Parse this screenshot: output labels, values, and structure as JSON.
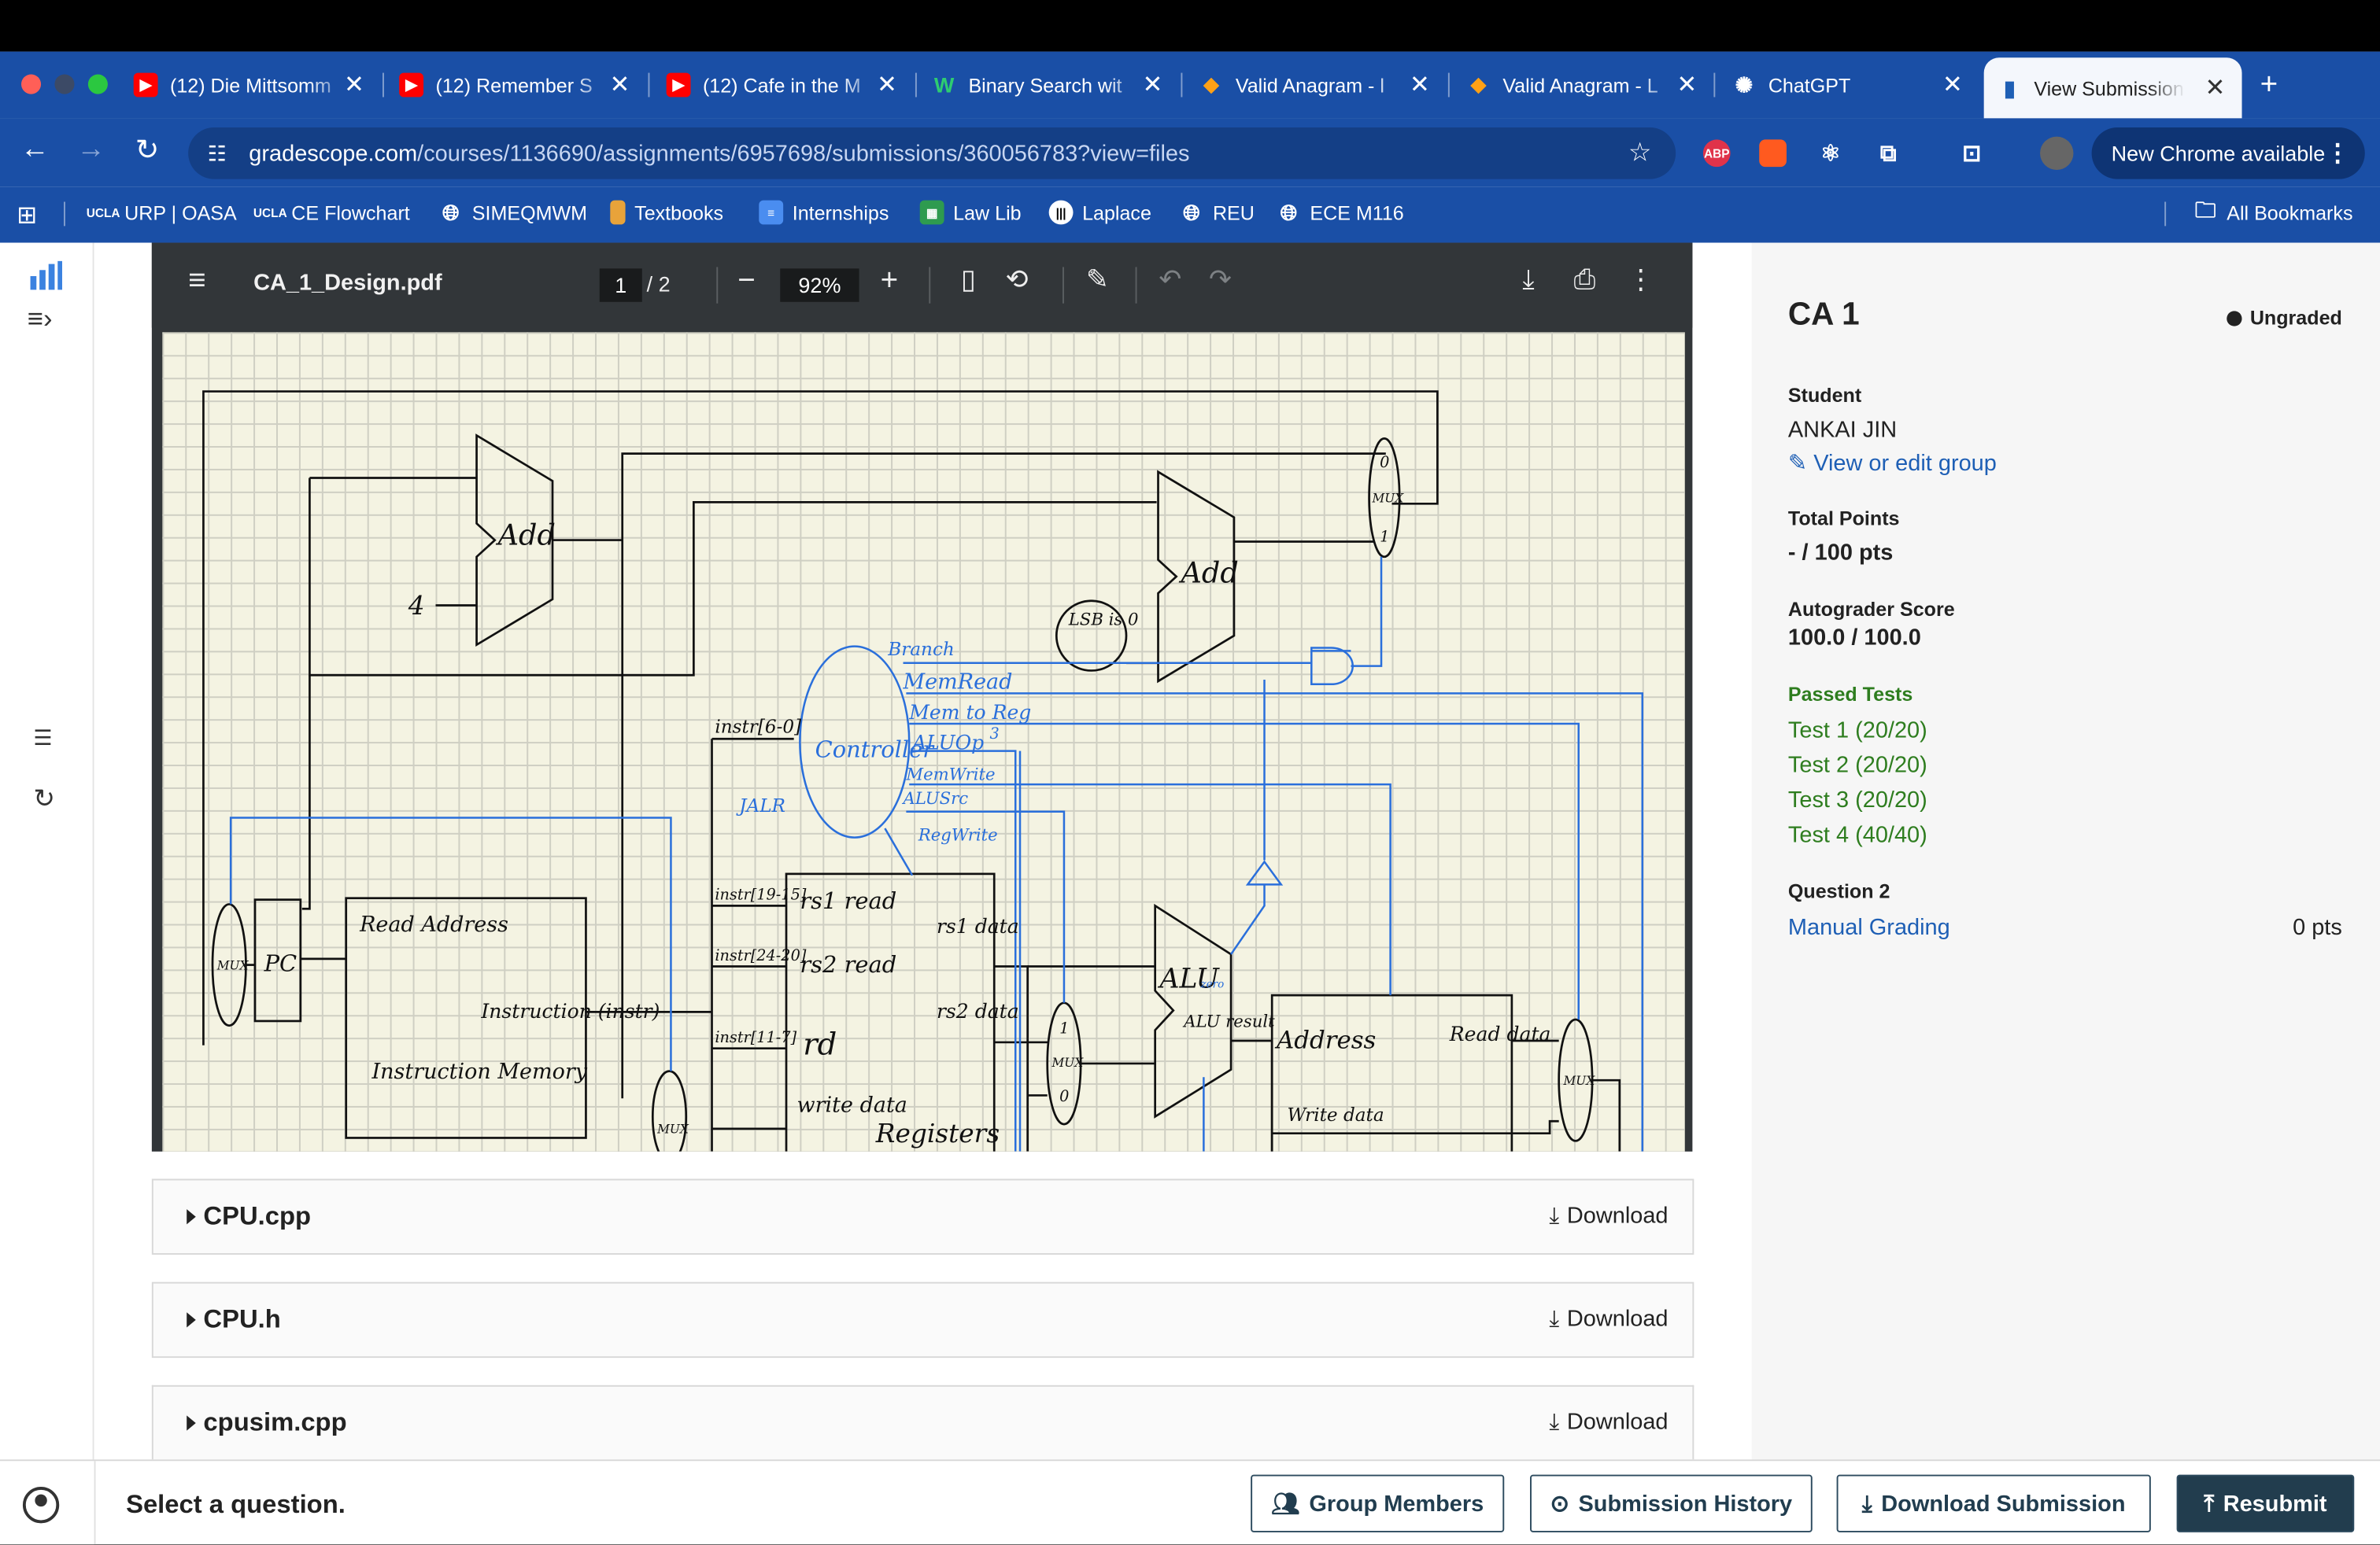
{
  "browser": {
    "tabs": [
      {
        "title": "(12) Die Mittsomm",
        "favicon": "youtube-icon"
      },
      {
        "title": "(12) Remember S",
        "favicon": "youtube-icon"
      },
      {
        "title": "(12) Cafe in the M",
        "favicon": "youtube-icon"
      },
      {
        "title": "Binary Search wit",
        "favicon": "w-logo-icon"
      },
      {
        "title": "Valid Anagram - l",
        "favicon": "leetcode-icon"
      },
      {
        "title": "Valid Anagram - L",
        "favicon": "leetcode-icon"
      },
      {
        "title": "ChatGPT",
        "favicon": "chatgpt-icon"
      },
      {
        "title": "View Submission",
        "favicon": "gradescope-icon",
        "active": true
      }
    ],
    "url_host": "gradescope.com",
    "url_path": "/courses/1136690/assignments/6957698/submissions/360056783?view=files",
    "new_chrome_label": "New Chrome available",
    "extensions": [
      "ABP",
      "brave-shield",
      "react",
      "puzzle"
    ],
    "bookmarks": [
      {
        "label": "URP | OASA",
        "icon": "ucla-icon"
      },
      {
        "label": "CE Flowchart",
        "icon": "ucla-icon"
      },
      {
        "label": "SIMEQMWM",
        "icon": "globe-icon"
      },
      {
        "label": "Textbooks",
        "icon": "folder-icon"
      },
      {
        "label": "Internships",
        "icon": "doc-icon"
      },
      {
        "label": "Law Lib",
        "icon": "sheet-icon"
      },
      {
        "label": "Laplace",
        "icon": "laplace-icon"
      },
      {
        "label": "REU",
        "icon": "globe-icon"
      },
      {
        "label": "ECE M116",
        "icon": "globe-icon"
      }
    ],
    "all_bookmarks_label": "All Bookmarks"
  },
  "pdf": {
    "filename": "CA_1_Design.pdf",
    "page": "1",
    "page_total": "/ 2",
    "zoom": "92%",
    "diagram_labels": {
      "add1": "Add",
      "add2": "Add",
      "four": "4",
      "mux": "MUX",
      "pc": "PC",
      "read_address": "Read Address",
      "instruction": "Instruction (instr)",
      "instruction_memory": "Instruction Memory",
      "controller": "Controller",
      "instr_6_0": "instr[6-0]",
      "instr_19_15": "instr[19-15]",
      "instr_24_20": "instr[24-20]",
      "instr_11_7": "instr[11-7]",
      "rs1_read": "rs1 read",
      "rs2_read": "rs2 read",
      "rd": "rd",
      "write_data": "write data",
      "registers": "Registers",
      "rs1_data": "rs1 data",
      "rs2_data": "rs2 data",
      "alu": "ALU",
      "zero": "zero",
      "alu_result": "ALU result",
      "lsb_is_0": "LSB is 0",
      "address": "Address",
      "read_data": "Read data",
      "write_data_mem": "Write data",
      "branch": "Branch",
      "memread": "MemRead",
      "memtoreg": "Mem to Reg",
      "aluop": "ALUOp",
      "aluop_bits": "3",
      "memwrite": "MemWrite",
      "alusrc": "ALUSrc",
      "regwrite": "RegWrite",
      "jalr": "JALR",
      "one": "1",
      "zero_digit": "0"
    }
  },
  "files": [
    {
      "name": "CPU.cpp",
      "action": "Download"
    },
    {
      "name": "CPU.h",
      "action": "Download"
    },
    {
      "name": "cpusim.cpp",
      "action": "Download"
    }
  ],
  "sidebar": {
    "title": "CA 1",
    "status": "Ungraded",
    "student_label": "Student",
    "student_name": "ANKAI JIN",
    "edit_group_link": "View or edit group",
    "total_points_label": "Total Points",
    "total_points": "- / 100 pts",
    "autograder_label": "Autograder Score",
    "autograder_score": "100.0 / 100.0",
    "passed_tests_label": "Passed Tests",
    "tests": [
      "Test 1 (20/20)",
      "Test 2 (20/20)",
      "Test 3 (20/20)",
      "Test 4 (40/40)"
    ],
    "question_label": "Question 2",
    "manual_grading": "Manual Grading",
    "manual_points": "0 pts"
  },
  "footer": {
    "prompt": "Select a question.",
    "group_members": "Group Members",
    "submission_history": "Submission History",
    "download_submission": "Download Submission",
    "resubmit": "Resubmit"
  },
  "colors": {
    "chrome_blue": "#1a4fa6",
    "link_blue": "#1e5fb5",
    "pass_green": "#2e7d1f",
    "resubmit_bg": "#223d4e",
    "diagram_blue": "#2a6fdb"
  }
}
